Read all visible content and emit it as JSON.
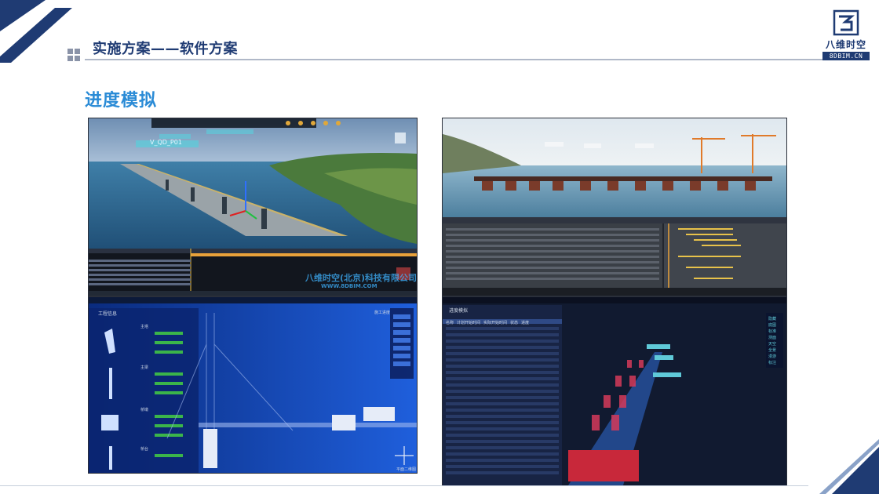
{
  "header": {
    "title": "实施方案——软件方案"
  },
  "logo": {
    "name_cn": "八维时空",
    "name_en": "8DBIM.CN"
  },
  "section": {
    "title": "进度模拟"
  },
  "screenshots": {
    "top_left": {
      "label_tag": "V_QD_P01",
      "watermark_cn": "八维时空(北京)科技有限公司",
      "watermark_url": "WWW.8DBIM.COM"
    },
    "bottom_left": {
      "panel_title": "工程信息",
      "groups": [
        "主塔",
        "主梁",
        "桥墩",
        "桥台"
      ],
      "right_menu": [
        "施工进度"
      ],
      "compass_label": "平面二维图"
    },
    "bottom_right": {
      "panel_title": "进度模拟",
      "side_menu": [
        "隐藏",
        "底图",
        "标准",
        "测面",
        "天空",
        "全景",
        "漫游",
        "标注"
      ],
      "table_headers": [
        "名称",
        "计划开始时间",
        "实际开始时间",
        "状态",
        "进度",
        "关联"
      ]
    }
  },
  "colors": {
    "brand_dark": "#1f3b73",
    "accent_blue": "#2a8bd6",
    "header_gray": "#8a93a8"
  }
}
